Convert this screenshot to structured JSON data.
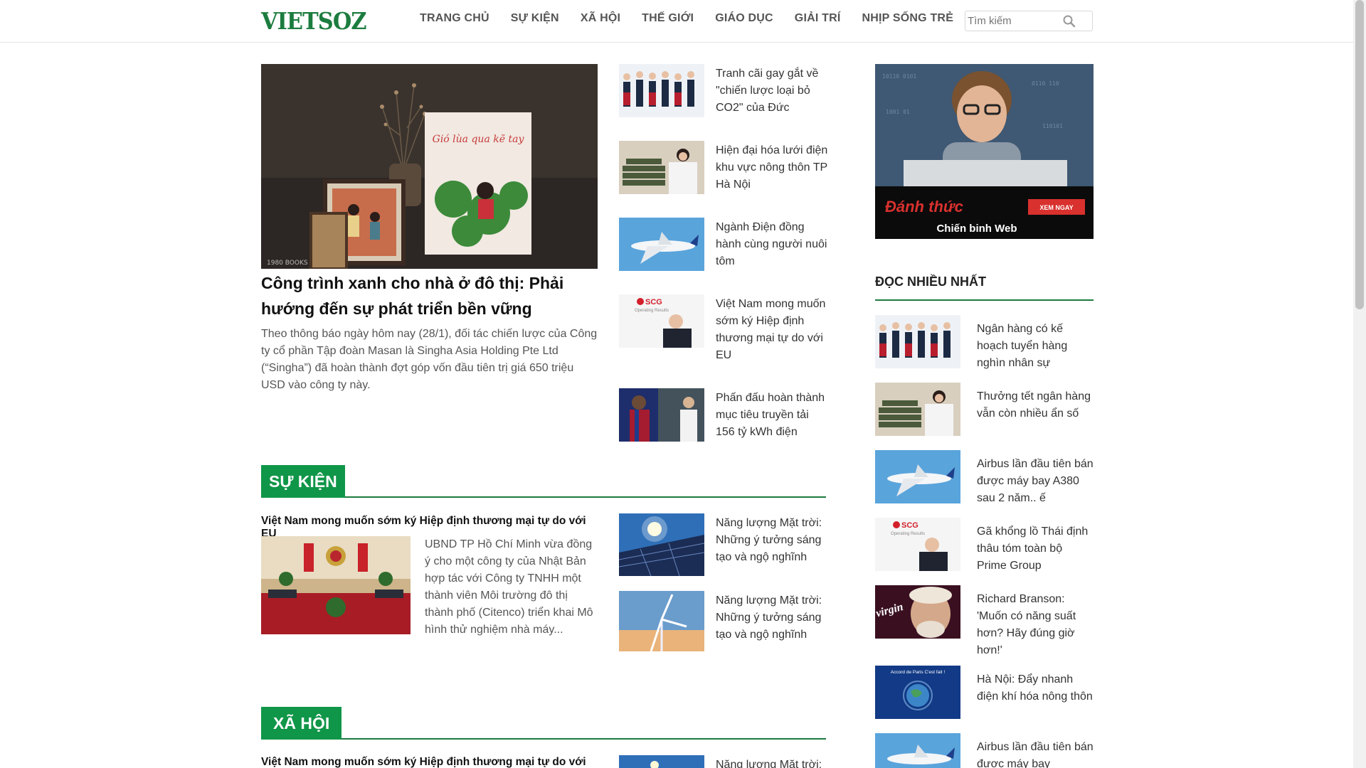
{
  "header": {
    "logo": "VIETSOZ",
    "nav": [
      "TRANG CHỦ",
      "SỰ KIỆN",
      "XÃ HỘI",
      "THẾ GIỚI",
      "GIÁO DỤC",
      "GIẢI TRÍ",
      "NHỊP SỐNG TRẺ"
    ],
    "search_placeholder": "Tìm kiếm"
  },
  "featured": {
    "title": "Công trình xanh cho nhà ở đô thị: Phải hướng đến sự phát triển bền vững",
    "description": "Theo thông báo ngày hôm nay (28/1), đối tác chiến lược của Công ty cổ phần Tập đoàn Masan là Singha Asia Holding Pte Ltd (“Singha”) đã hoàn thành đợt góp vốn đầu tiên trị giá 650 triệu USD vào công ty này.",
    "image_book_text": "Gió lùa qua kẽ tay",
    "image_logo_text": "1980 BOOKS"
  },
  "top_list": [
    "Tranh cãi gay gắt về \"chiến lược loại bỏ CO2\" của Đức",
    "Hiện đại hóa lưới điện khu vực nông thôn TP Hà Nội",
    "Ngành Điện đồng hành cùng người nuôi tôm",
    "Việt Nam mong muốn sớm ký Hiệp định thương mại tự do với EU",
    "Phấn đấu hoàn thành mục tiêu truyền tải 156 tỷ kWh điện"
  ],
  "section_su_kien": {
    "label": "SỰ KIỆN",
    "main_title": "Việt Nam mong muốn sớm ký Hiệp định thương mại tự do với EU",
    "main_desc": "UBND TP Hồ Chí Minh vừa đồng ý cho một công ty của Nhật Bản hợp tác với Công ty TNHH một thành viên Môi trường đô thị thành phố (Citenco) triển khai Mô hình thử nghiệm nhà máy...",
    "side": [
      "Năng lượng Mặt trời: Những ý tưởng sáng tạo và ngộ nghĩnh",
      "Năng lượng Mặt trời: Những ý tưởng sáng tạo và ngộ nghĩnh"
    ]
  },
  "section_xa_hoi": {
    "label": "XÃ HỘI",
    "main_title": "Việt Nam mong muốn sớm ký Hiệp định thương mại tự do với EU",
    "side_first": "Năng lượng Mặt trời:"
  },
  "sidebar": {
    "ad_title": "Đánh thức",
    "ad_subtitle": "Chiến binh Web",
    "ad_button": "XEM NGAY",
    "heading": "ĐỌC NHIỀU NHẤT",
    "items": [
      "Ngân hàng có kế hoạch tuyển hàng nghìn nhân sự",
      "Thưởng tết ngân hàng vẫn còn nhiều ẩn số",
      "Airbus lần đầu tiên bán được máy bay A380 sau 2 năm.. ế",
      "Gã khổng lồ Thái định thâu tóm toàn bộ Prime Group",
      "Richard Branson: 'Muốn có năng suất hơn? Hãy đúng giờ hơn!'",
      "Hà Nội: Đẩy nhanh điện khí hóa nông thôn",
      "Airbus lần đầu tiên bán được máy bay"
    ]
  },
  "thumb_texts": {
    "scg_logo": "SCG",
    "scg_sub": "Operating Results",
    "virgin": "virgin",
    "paris": "Accord de Paris C'est fait !"
  },
  "colors": {
    "brand_green": "#1c7c3f",
    "section_green": "#109648"
  }
}
